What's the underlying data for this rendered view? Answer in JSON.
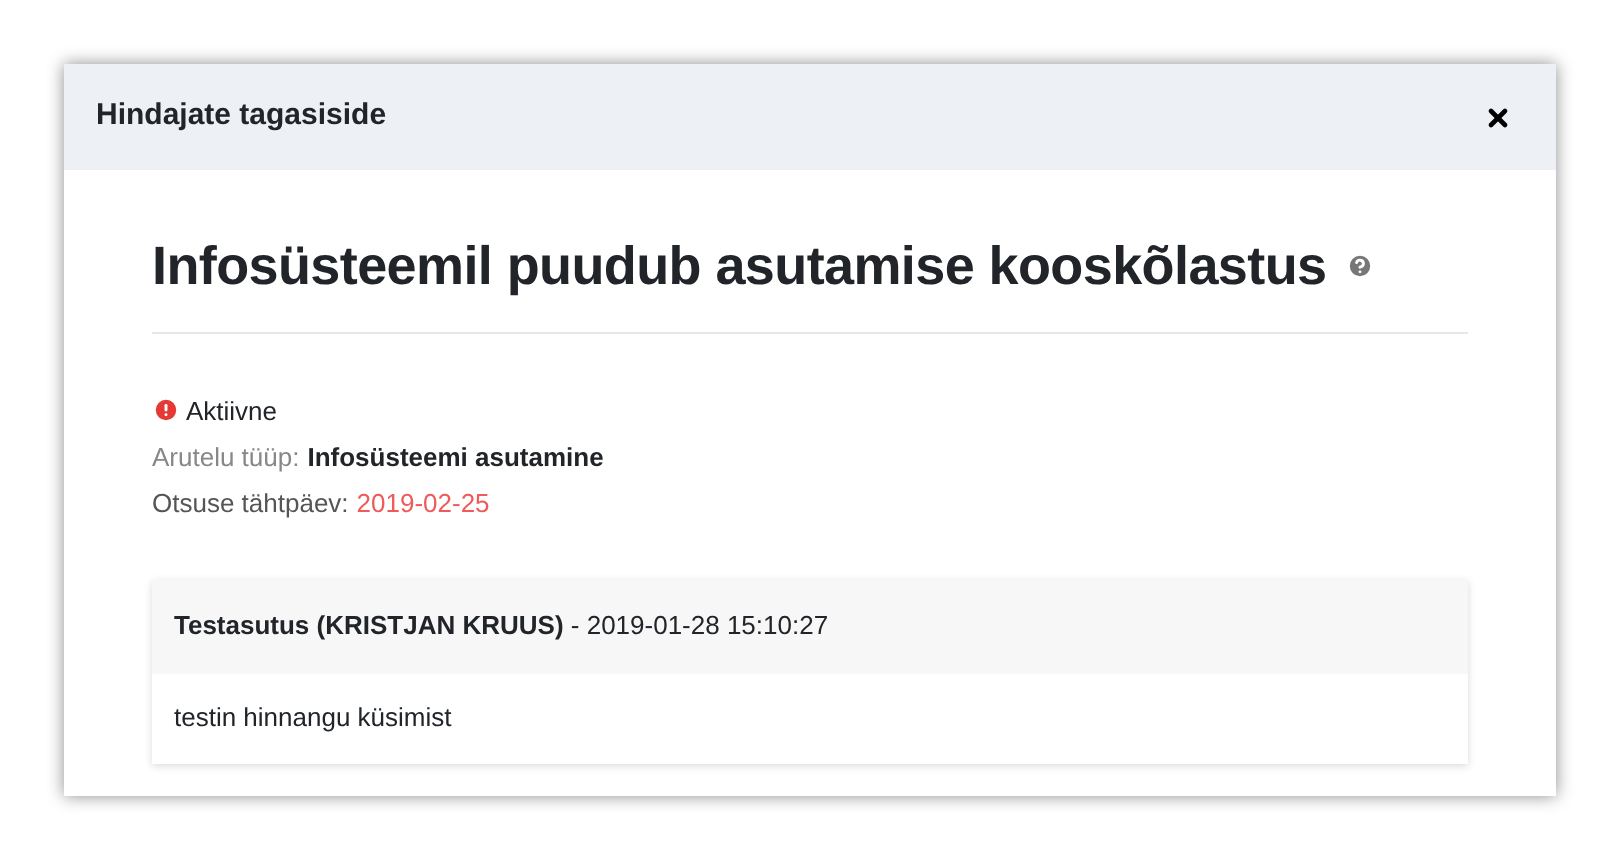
{
  "dialog": {
    "title": "Hindajate tagasiside"
  },
  "heading": "Infosüsteemil puudub asutamise kooskõlastus",
  "status": {
    "kind": "active",
    "label": "Aktiivne"
  },
  "discussion_type": {
    "label": "Arutelu tüüp:",
    "value": "Infosüsteemi asutamine"
  },
  "deadline": {
    "label": "Otsuse tähtpäev:",
    "value": "2019-02-25",
    "overdue": true
  },
  "comments": [
    {
      "header": "**Testasutus (KRISTJAN KRUUS)** - 2019-01-28 15:10:27",
      "body": "testin hinnangu küsimist"
    }
  ]
}
